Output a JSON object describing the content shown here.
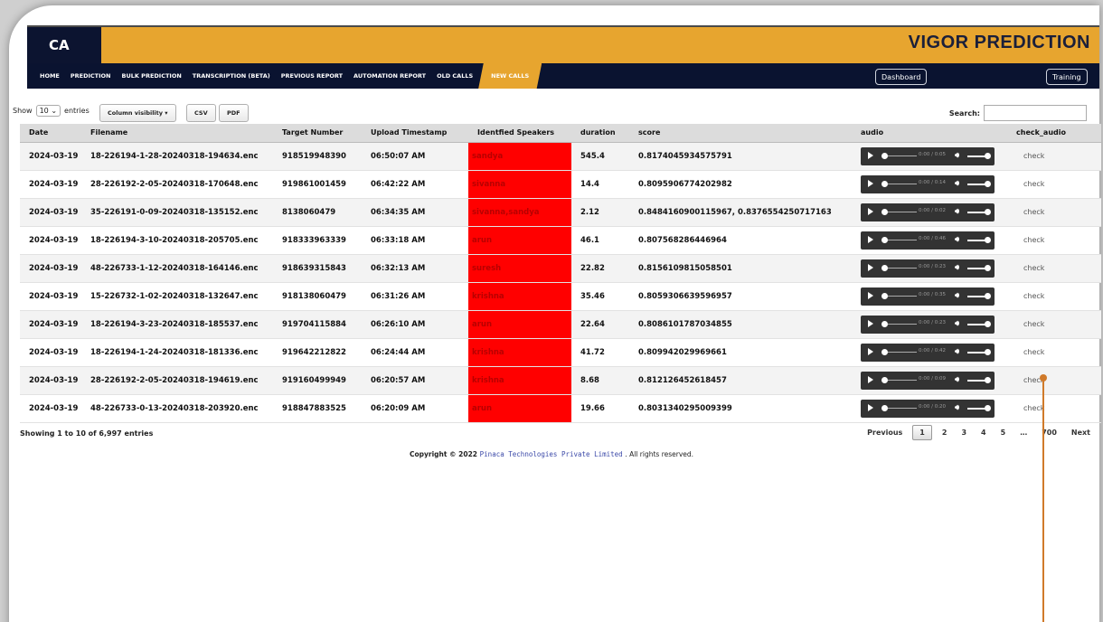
{
  "brand": {
    "logo_text": "CA",
    "app_title": "VIGOR PREDICTION"
  },
  "nav": {
    "items": [
      "HOME",
      "PREDICTION",
      "BULK PREDICTION",
      "TRANSCRIPTION (BETA)",
      "PREVIOUS REPORT",
      "AUTOMATION REPORT",
      "OLD CALLS",
      "NEW CALLS"
    ],
    "active": "NEW CALLS",
    "dashboard_label": "Dashboard",
    "training_label": "Training"
  },
  "controls": {
    "show_label": "Show",
    "entries_value": "10",
    "entries_label": "entries",
    "column_visibility_label": "Column visibility",
    "csv_label": "CSV",
    "pdf_label": "PDF",
    "search_label": "Search:"
  },
  "table": {
    "columns": [
      "Date",
      "Filename",
      "Target Number",
      "Upload Timestamp",
      "Identfied Speakers",
      "duration",
      "score",
      "audio",
      "check_audio"
    ],
    "rows": [
      {
        "date": "2024-03-19",
        "filename": "18-226194-1-28-20240318-194634.enc",
        "target": "918519948390",
        "upload": "06:50:07 AM",
        "speakers": "sandya",
        "duration": "545.4",
        "score": "0.8174045934575791",
        "audio_time": "0:00 / 0:05",
        "check": "check"
      },
      {
        "date": "2024-03-19",
        "filename": "28-226192-2-05-20240318-170648.enc",
        "target": "919861001459",
        "upload": "06:42:22 AM",
        "speakers": "sivanna",
        "duration": "14.4",
        "score": "0.8095906774202982",
        "audio_time": "0:00 / 0:14",
        "check": "check"
      },
      {
        "date": "2024-03-19",
        "filename": "35-226191-0-09-20240318-135152.enc",
        "target": "8138060479",
        "upload": "06:34:35 AM",
        "speakers": "sivanna,sandya",
        "duration": "2.12",
        "score": "0.8484160900115967, 0.8376554250717163",
        "audio_time": "0:00 / 0:02",
        "check": "check"
      },
      {
        "date": "2024-03-19",
        "filename": "18-226194-3-10-20240318-205705.enc",
        "target": "918333963339",
        "upload": "06:33:18 AM",
        "speakers": "arun",
        "duration": "46.1",
        "score": "0.807568286446964",
        "audio_time": "0:00 / 0:46",
        "check": "check"
      },
      {
        "date": "2024-03-19",
        "filename": "48-226733-1-12-20240318-164146.enc",
        "target": "918639315843",
        "upload": "06:32:13 AM",
        "speakers": "suresh",
        "duration": "22.82",
        "score": "0.8156109815058501",
        "audio_time": "0:00 / 0:23",
        "check": "check"
      },
      {
        "date": "2024-03-19",
        "filename": "15-226732-1-02-20240318-132647.enc",
        "target": "918138060479",
        "upload": "06:31:26 AM",
        "speakers": "krishna",
        "duration": "35.46",
        "score": "0.8059306639596957",
        "audio_time": "0:00 / 0:35",
        "check": "check"
      },
      {
        "date": "2024-03-19",
        "filename": "18-226194-3-23-20240318-185537.enc",
        "target": "919704115884",
        "upload": "06:26:10 AM",
        "speakers": "arun",
        "duration": "22.64",
        "score": "0.8086101787034855",
        "audio_time": "0:00 / 0:23",
        "check": "check"
      },
      {
        "date": "2024-03-19",
        "filename": "18-226194-1-24-20240318-181336.enc",
        "target": "919642212822",
        "upload": "06:24:44 AM",
        "speakers": "krishna",
        "duration": "41.72",
        "score": "0.809942029969661",
        "audio_time": "0:00 / 0:42",
        "check": "check"
      },
      {
        "date": "2024-03-19",
        "filename": "28-226192-2-05-20240318-194619.enc",
        "target": "919160499949",
        "upload": "06:20:57 AM",
        "speakers": "krishna",
        "duration": "8.68",
        "score": "0.812126452618457",
        "audio_time": "0:00 / 0:09",
        "check": "check"
      },
      {
        "date": "2024-03-19",
        "filename": "48-226733-0-13-20240318-203920.enc",
        "target": "918847883525",
        "upload": "06:20:09 AM",
        "speakers": "arun",
        "duration": "19.66",
        "score": "0.8031340295009399",
        "audio_time": "0:00 / 0:20",
        "check": "check"
      }
    ]
  },
  "footer": {
    "info": "Showing 1 to 10 of 6,997 entries",
    "previous": "Previous",
    "pages": [
      "1",
      "2",
      "3",
      "4",
      "5",
      "…",
      "700"
    ],
    "current_page": "1",
    "next": "Next",
    "copyright_prefix": "Copyright © 2022",
    "copyright_company": "Pinaca Technologies Private Limited",
    "copyright_suffix": ". All rights reserved."
  },
  "colors": {
    "accent": "#e7a52f",
    "nav_bg": "#0a1330",
    "speaker_bg": "#ff0000"
  }
}
